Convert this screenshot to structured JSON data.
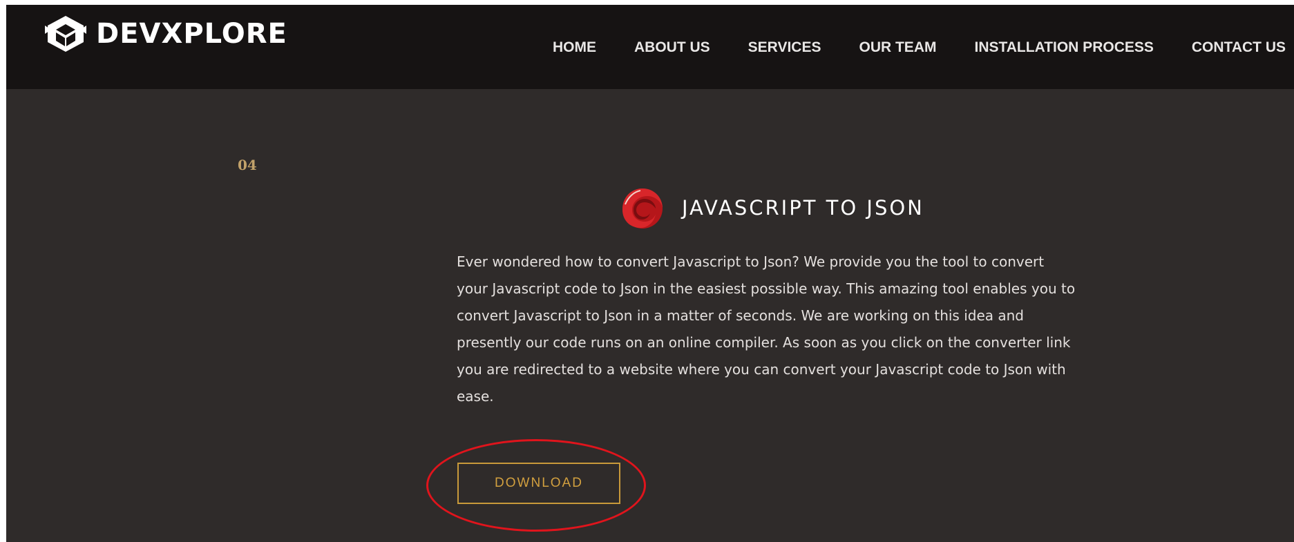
{
  "navbar": {
    "brand": "DEVXPLORE",
    "links": [
      "HOME",
      "ABOUT US",
      "SERVICES",
      "OUR TEAM",
      "INSTALLATION PROCESS",
      "CONTACT US"
    ]
  },
  "service": {
    "step": "04",
    "title": "JAVASCRIPT TO JSON",
    "description": "Ever wondered how to convert Javascript to Json? We provide you the tool to convert your Javascript code to Json in the easiest possible way. This amazing tool enables you to convert Javascript to Json in a matter of seconds. We are working on this idea and presently our code runs on an online compiler. As soon as you click on the converter link you are redirected to a website where you can convert your Javascript code to Json with ease.",
    "icon": "swirl-logo-icon",
    "button_label": "DOWNLOAD"
  },
  "annotation": {
    "color": "#e0141c",
    "target": "download-button"
  },
  "colors": {
    "nav_background": "#161313",
    "page_background": "#2f2b2a",
    "accent_gold": "#c99a3a",
    "step_number": "#c2a26a"
  }
}
